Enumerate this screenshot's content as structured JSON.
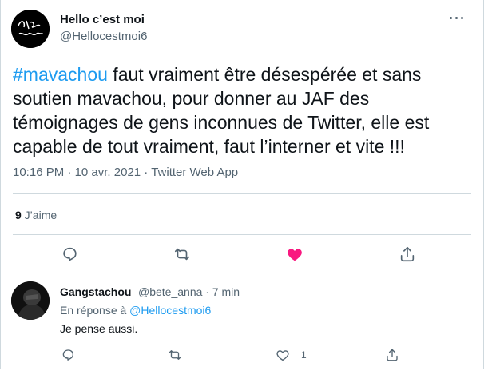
{
  "tweet": {
    "display_name": "Hello c’est moi",
    "handle": "@Hellocestmoi6",
    "hashtag": "#mavachou",
    "text": " faut vraiment être désespérée et sans soutien mavachou, pour donner au JAF des témoignages de gens inconnues de Twitter, elle est capable de tout vraiment, faut l’interner et vite !!!",
    "time": "10:16 PM",
    "dot1": " · ",
    "date": "10 avr. 2021",
    "dot2": " · ",
    "source": "Twitter Web App",
    "likes_count": "9",
    "likes_label": " J’aime",
    "icons": [
      "more-icon",
      "reply-icon",
      "retweet-icon",
      "like-filled-icon",
      "share-icon"
    ]
  },
  "reply": {
    "display_name": "Gangstachou",
    "handle": "@bete_anna",
    "separator": " · ",
    "time": "7 min",
    "in_reply_prefix": "En réponse à ",
    "in_reply_handle": "@Hellocestmoi6",
    "text": "Je pense aussi.",
    "like_count": "1"
  },
  "colors": {
    "accent": "#1d9bf0",
    "like": "#f91880",
    "secondary_text": "#536471",
    "border": "#cfd9de"
  }
}
